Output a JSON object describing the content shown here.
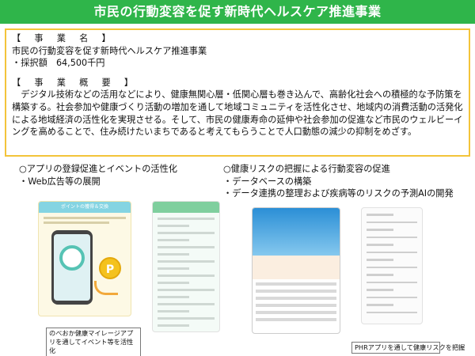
{
  "banner": {
    "title": "市民の行動変容を促す新時代ヘルスケア推進事業"
  },
  "info": {
    "name_heading": "【　事　業　名　】",
    "name_value": "市民の行動変容を促す新時代ヘルスケア推進事業",
    "amount": "・採択額　64,500千円",
    "summary_heading": "【　事　業　概　要　】",
    "summary": "デジタル技術などの活用などにより、健康無関心層・低関心層も巻き込んで、高齢化社会への積極的な予防策を構築する。社会参加や健康づくり活動の増加を通して地域コミュニティを活性化させ、地域内の消費活動の活発化による地域経済の活性化を実現させる。そして、市民の健康寿命の延伸や社会参加の促進など市民のウェルビーイングを高めることで、住み続けたいまちであると考えてもらうことで人口動態の減少の抑制をめざす。"
  },
  "left_column": {
    "line1": "○アプリの登録促進とイベントの活性化",
    "line2": "・Web広告等の展開",
    "shot_header": "ポイントの獲得＆交換",
    "coin_letter": "P",
    "caption": "のべおか健康マイレージアプリを通してイベント等を活性化"
  },
  "right_column": {
    "line1": "○健康リスクの把握による行動変容の促進",
    "line2": "・データベースの構築",
    "line3": "・データ連携の整理および疾病等のリスクの予測AIの開発",
    "caption": "PHRアプリを通して健康リスクを把握"
  },
  "colors": {
    "banner": "#2fb54a",
    "box_border": "#f3c43a"
  }
}
